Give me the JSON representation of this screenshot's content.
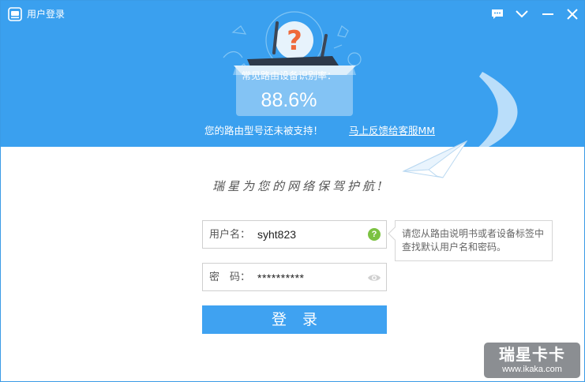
{
  "window": {
    "title": "用户登录",
    "accent_color": "#3aa0ef"
  },
  "titlebar_buttons": {
    "feedback": "chat-bubble-icon",
    "dropdown": "chevron-down-icon",
    "minimize": "minimize-icon",
    "close": "close-icon"
  },
  "header": {
    "recognition_label": "常见路由设备识别率：",
    "recognition_rate": "88.6%",
    "unsupported_text": "您的路由型号还未被支持！",
    "feedback_link": "马上反馈给客服MM"
  },
  "slogan": "瑞星为您的网络保驾护航!",
  "form": {
    "username": {
      "label": "用户名：",
      "value": "syht823"
    },
    "password": {
      "label": "密　码：",
      "value": "**********"
    },
    "tooltip": "请您从路由说明书或者设备标签中查找默认用户名和密码。",
    "login_button": "登录",
    "help_icon_glyph": "?"
  },
  "watermark": {
    "title": "瑞星卡卡",
    "url": "www.ikaka.com"
  }
}
